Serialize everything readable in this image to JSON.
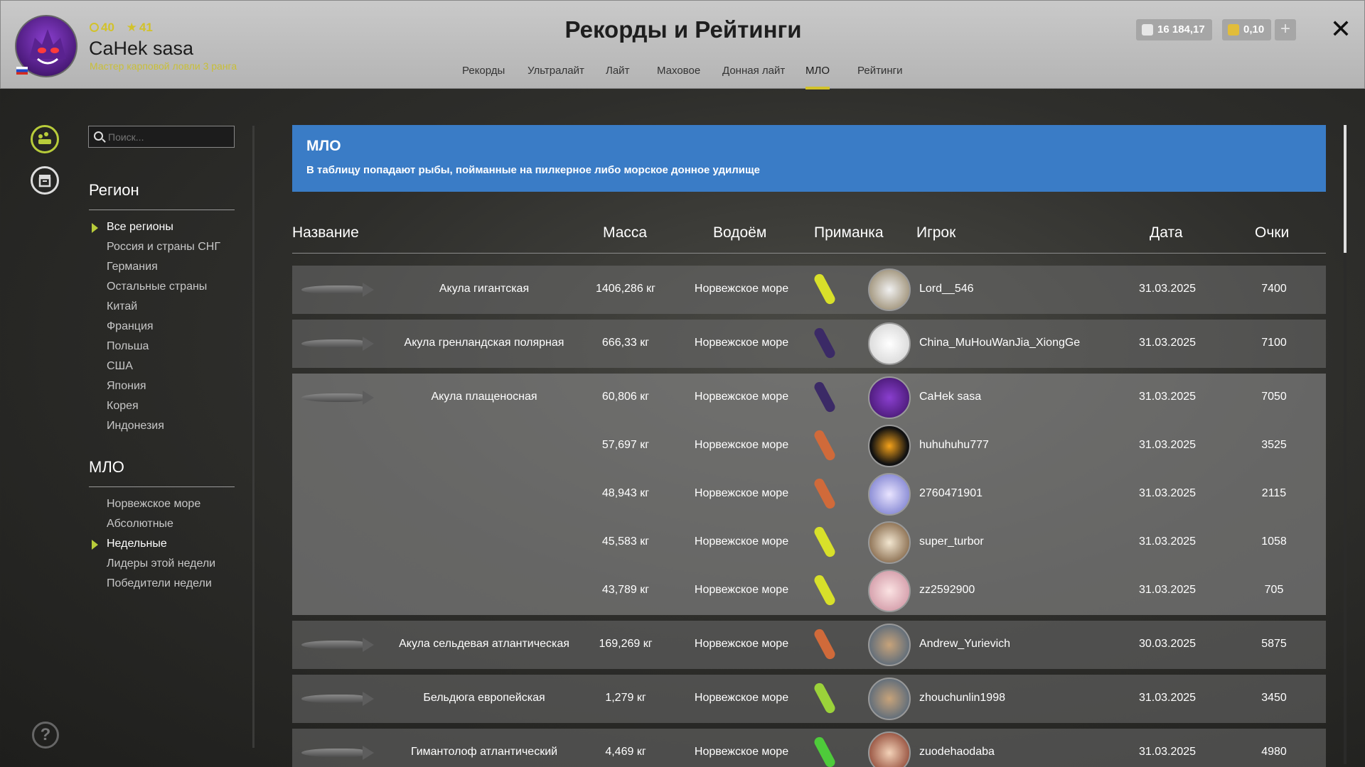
{
  "header": {
    "title": "Рекорды и Рейтинги",
    "stat_level": "40",
    "stat_stars": "41",
    "username": "CaHek sasa",
    "rank": "Мастер карповой ловли 3 ранга",
    "silver": "16 184,17",
    "gold": "0,10",
    "plus_label": "+",
    "close_label": "✕"
  },
  "tabs": [
    "Рекорды",
    "Ультралайт",
    "Лайт",
    "Маховое",
    "Донная лайт",
    "МЛО",
    "Рейтинги"
  ],
  "search": {
    "placeholder": "Поиск..."
  },
  "region": {
    "title": "Регион",
    "items": [
      "Все регионы",
      "Россия и страны СНГ",
      "Германия",
      "Остальные страны",
      "Китай",
      "Франция",
      "Польша",
      "США",
      "Япония",
      "Корея",
      "Индонезия"
    ]
  },
  "mlo": {
    "title": "МЛО",
    "items": [
      "Норвежское море",
      "Абсолютные",
      "Недельные",
      "Лидеры этой недели",
      "Победители недели"
    ]
  },
  "banner": {
    "title": "МЛО",
    "text": "В таблицу попадают рыбы, пойманные на пилкерное либо морское донное удилище"
  },
  "table": {
    "headers": [
      "Название",
      "Масса",
      "Водоём",
      "Приманка",
      "Игрок",
      "Дата",
      "Очки"
    ],
    "rows": [
      {
        "name": "Акула гигантская",
        "mass": "1406,286 кг",
        "water": "Норвежское море",
        "player": "Lord__546",
        "date": "31.03.2025",
        "points": "7400"
      },
      {
        "name": "Акула гренландская полярная",
        "mass": "666,33 кг",
        "water": "Норвежское море",
        "player": "China_MuHouWanJia_XiongGe",
        "date": "31.03.2025",
        "points": "7100"
      },
      {
        "name": "Акула плащеносная",
        "mass": "60,806 кг",
        "water": "Норвежское море",
        "player": "CaHek sasa",
        "date": "31.03.2025",
        "points": "7050"
      },
      {
        "name": "",
        "mass": "57,697 кг",
        "water": "Норвежское море",
        "player": "huhuhuhu777",
        "date": "31.03.2025",
        "points": "3525"
      },
      {
        "name": "",
        "mass": "48,943 кг",
        "water": "Норвежское море",
        "player": "2760471901",
        "date": "31.03.2025",
        "points": "2115"
      },
      {
        "name": "",
        "mass": "45,583 кг",
        "water": "Норвежское море",
        "player": "super_turbor",
        "date": "31.03.2025",
        "points": "1058"
      },
      {
        "name": "",
        "mass": "43,789 кг",
        "water": "Норвежское море",
        "player": "zz2592900",
        "date": "31.03.2025",
        "points": "705"
      },
      {
        "name": "Акула сельдевая атлантическая",
        "mass": "169,269 кг",
        "water": "Норвежское море",
        "player": "Andrew_Yurievich",
        "date": "30.03.2025",
        "points": "5875"
      },
      {
        "name": "Бельдюга европейская",
        "mass": "1,279 кг",
        "water": "Норвежское море",
        "player": "zhouchunlin1998",
        "date": "31.03.2025",
        "points": "3450"
      },
      {
        "name": "Гимантолоф атлантический",
        "mass": "4,469 кг",
        "water": "Норвежское море",
        "player": "zuodehaodaba",
        "date": "31.03.2025",
        "points": "4980"
      }
    ]
  },
  "colors": {
    "accent": "#d2c22a",
    "banner": "#3a7cc6",
    "lure_yellow": "#d8e02a",
    "lure_purple": "#3b2a66",
    "lure_orange": "#d06a3a",
    "lure_green": "#9bd23a"
  },
  "help_label": "?"
}
